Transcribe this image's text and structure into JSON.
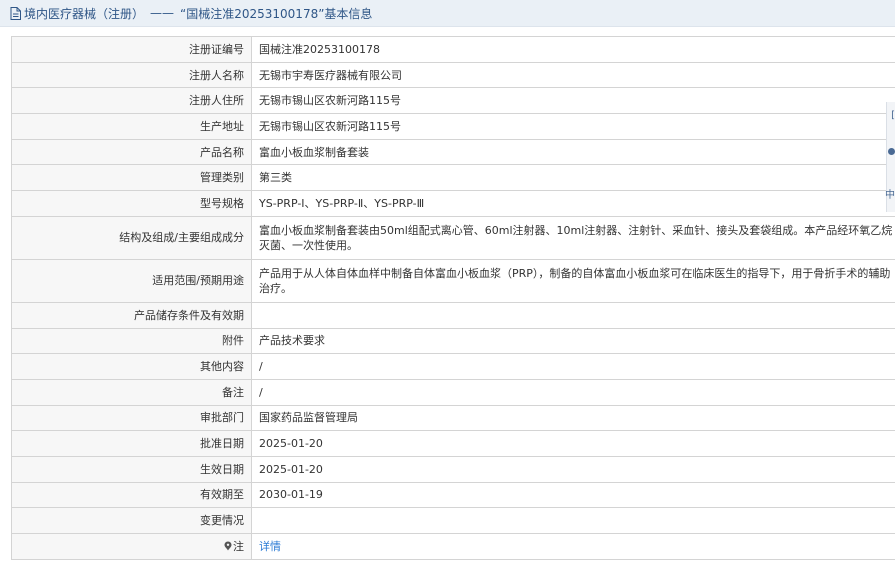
{
  "header": {
    "prefix": "境内医疗器械（注册）",
    "separator": "——",
    "record_title": "“国械注准20253100178”基本信息"
  },
  "rows": [
    {
      "label": "注册证编号",
      "value": "国械注准20253100178"
    },
    {
      "label": "注册人名称",
      "value": "无锡市宇寿医疗器械有限公司"
    },
    {
      "label": "注册人住所",
      "value": "无锡市锡山区农新河路115号"
    },
    {
      "label": "生产地址",
      "value": "无锡市锡山区农新河路115号"
    },
    {
      "label": "产品名称",
      "value": "富血小板血浆制备套装"
    },
    {
      "label": "管理类别",
      "value": "第三类"
    },
    {
      "label": "型号规格",
      "value": "YS-PRP-Ⅰ、YS-PRP-Ⅱ、YS-PRP-Ⅲ"
    },
    {
      "label": "结构及组成/主要组成成分",
      "value": "富血小板血浆制备套装由50ml组配式离心管、60ml注射器、10ml注射器、注射针、采血针、接头及套袋组成。本产品经环氧乙烷灭菌、一次性使用。"
    },
    {
      "label": "适用范围/预期用途",
      "value": "产品用于从人体自体血样中制备自体富血小板血浆（PRP），制备的自体富血小板血浆可在临床医生的指导下，用于骨折手术的辅助治疗。"
    },
    {
      "label": "产品储存条件及有效期",
      "value": ""
    },
    {
      "label": "附件",
      "value": "产品技术要求"
    },
    {
      "label": "其他内容",
      "value": "/"
    },
    {
      "label": "备注",
      "value": "/"
    },
    {
      "label": "审批部门",
      "value": "国家药品监督管理局"
    },
    {
      "label": "批准日期",
      "value": "2025-01-20"
    },
    {
      "label": "生效日期",
      "value": "2025-01-20"
    },
    {
      "label": "有效期至",
      "value": "2030-01-19"
    },
    {
      "label": "变更情况",
      "value": ""
    }
  ],
  "note_row": {
    "label": "注",
    "link_text": "详情",
    "icon": "pin-icon"
  },
  "side_tab": {
    "glyph1": "[",
    "glyph2": "中"
  },
  "colors": {
    "header_bg": "#eaf0f6",
    "header_text": "#2f5687",
    "link": "#2a7ad4",
    "label_bg": "#f7f7f7",
    "border": "#d4d4d4"
  }
}
